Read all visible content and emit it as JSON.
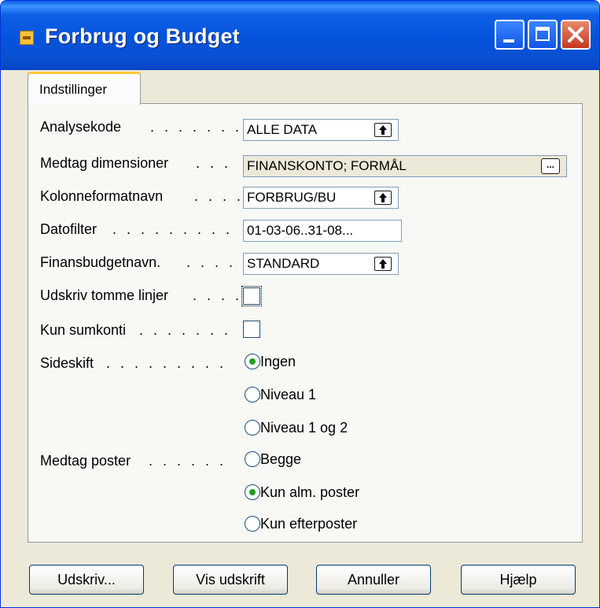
{
  "window": {
    "title": "Forbrug og Budget"
  },
  "tabs": [
    {
      "label": "Indstillinger"
    }
  ],
  "fields": {
    "analysekode": {
      "label": "Analysekode",
      "dots": ". . . . . . .",
      "value": "ALLE DATA"
    },
    "medtag_dimensioner": {
      "label": "Medtag dimensioner",
      "dots": ". . .",
      "value": "FINANSKONTO; FORMÅL"
    },
    "kolonneformatnavn": {
      "label": "Kolonneformatnavn",
      "dots": ". . . .",
      "value": "FORBRUG/BU"
    },
    "datofilter": {
      "label": "Datofilter",
      "dots": ". . . . . . . . .",
      "value": "01-03-06..31-08..."
    },
    "finansbudgetnavn": {
      "label": "Finansbudgetnavn.",
      "dots": ". . . .",
      "value": "STANDARD"
    },
    "udskriv_tomme_linjer": {
      "label": "Udskriv tomme linjer",
      "dots": ". . . .",
      "checked": false
    },
    "kun_sumkonti": {
      "label": "Kun sumkonti",
      "dots": ". . . . . . .",
      "checked": false
    }
  },
  "sideskift": {
    "label": "Sideskift",
    "dots": ". . . . . . . . .",
    "options": [
      "Ingen",
      "Niveau 1",
      "Niveau 1 og 2"
    ],
    "selected": "Ingen"
  },
  "medtag_poster": {
    "label": "Medtag poster",
    "dots": ". . . . . .",
    "options": [
      "Begge",
      "Kun alm. poster",
      "Kun efterposter"
    ],
    "selected": "Kun alm. poster"
  },
  "buttons": {
    "print": "Udskriv...",
    "preview": "Vis udskrift",
    "cancel": "Annuller",
    "help": "Hjælp"
  },
  "colors": {
    "titlebar": "#0553dc",
    "tab_accent": "#ffc73c",
    "radio_dot": "#21a121",
    "close_button": "#c6381d"
  }
}
